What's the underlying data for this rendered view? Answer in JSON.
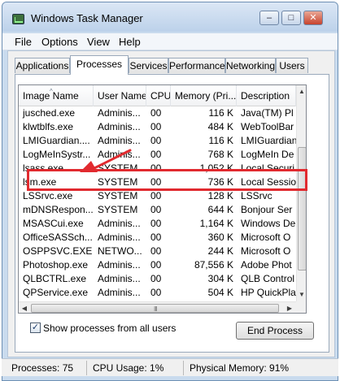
{
  "window": {
    "title": "Windows Task Manager"
  },
  "title_buttons": {
    "minimize": "–",
    "maximize": "□",
    "close": "✕"
  },
  "menu": [
    "File",
    "Options",
    "View",
    "Help"
  ],
  "tabs": [
    {
      "label": "Applications",
      "active": false
    },
    {
      "label": "Processes",
      "active": true
    },
    {
      "label": "Services",
      "active": false
    },
    {
      "label": "Performance",
      "active": false
    },
    {
      "label": "Networking",
      "active": false
    },
    {
      "label": "Users",
      "active": false
    }
  ],
  "columns": [
    "Image Name",
    "User Name",
    "CPU",
    "Memory (Pri...",
    "Description"
  ],
  "processes": [
    {
      "image": "jusched.exe",
      "user": "Adminis...",
      "cpu": "00",
      "memory": "116 K",
      "desc": "Java(TM) Pl"
    },
    {
      "image": "klwtblfs.exe",
      "user": "Adminis...",
      "cpu": "00",
      "memory": "484 K",
      "desc": "WebToolBar"
    },
    {
      "image": "LMIGuardian....",
      "user": "Adminis...",
      "cpu": "00",
      "memory": "116 K",
      "desc": "LMIGuardian"
    },
    {
      "image": "LogMeInSystr...",
      "user": "Adminis...",
      "cpu": "00",
      "memory": "768 K",
      "desc": "LogMeIn De"
    },
    {
      "image": "lsass.exe",
      "user": "SYSTEM",
      "cpu": "00",
      "memory": "1,052 K",
      "desc": "Local Securi"
    },
    {
      "image": "lsm.exe",
      "user": "SYSTEM",
      "cpu": "00",
      "memory": "736 K",
      "desc": "Local Sessio"
    },
    {
      "image": "LSSrvc.exe",
      "user": "SYSTEM",
      "cpu": "00",
      "memory": "128 K",
      "desc": "LSSrvc"
    },
    {
      "image": "mDNSRespon...",
      "user": "SYSTEM",
      "cpu": "00",
      "memory": "644 K",
      "desc": "Bonjour Ser"
    },
    {
      "image": "MSASCui.exe",
      "user": "Adminis...",
      "cpu": "00",
      "memory": "1,164 K",
      "desc": "Windows De"
    },
    {
      "image": "OfficeSASSch...",
      "user": "Adminis...",
      "cpu": "00",
      "memory": "360 K",
      "desc": "Microsoft O"
    },
    {
      "image": "OSPPSVC.EXE",
      "user": "NETWO...",
      "cpu": "00",
      "memory": "244 K",
      "desc": "Microsoft O"
    },
    {
      "image": "Photoshop.exe",
      "user": "Adminis...",
      "cpu": "00",
      "memory": "87,556 K",
      "desc": "Adobe Phot"
    },
    {
      "image": "QLBCTRL.exe",
      "user": "Adminis...",
      "cpu": "00",
      "memory": "304 K",
      "desc": "QLB Control"
    },
    {
      "image": "QPService.exe",
      "user": "Adminis...",
      "cpu": "00",
      "memory": "504 K",
      "desc": "HP QuickPla"
    }
  ],
  "show_all_label": "Show processes from all users",
  "show_all_checked": "✓",
  "end_process_label": "End Process",
  "status": {
    "processes": "Processes: 75",
    "cpu": "CPU Usage: 1%",
    "memory": "Physical Memory: 91%"
  },
  "scroll": {
    "up": "▲",
    "down": "▼",
    "left": "◀",
    "right": "▶",
    "grip": "III"
  },
  "sort_indicator": "^",
  "annotation_color": "#e12a2f"
}
